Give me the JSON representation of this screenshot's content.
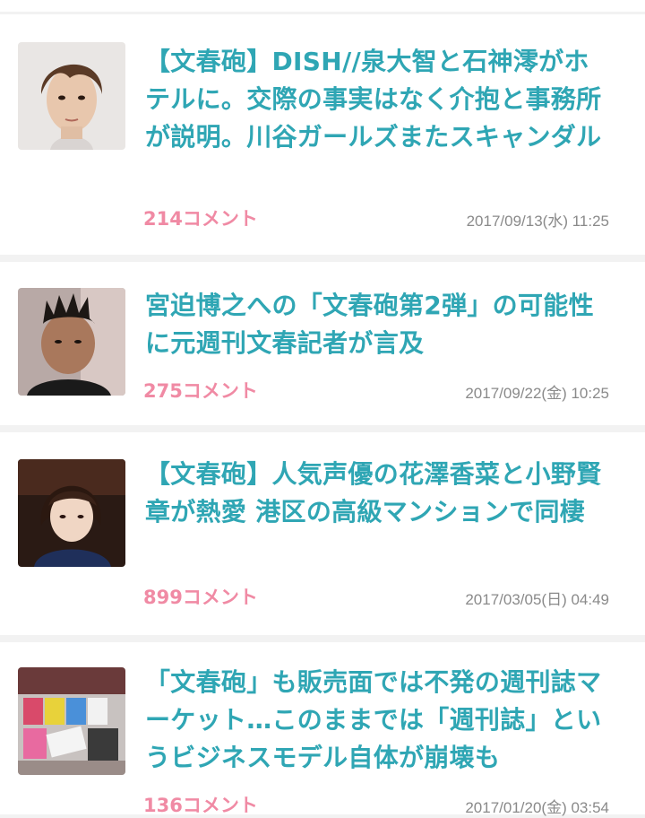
{
  "articles": [
    {
      "title": "【文春砲】DISH//泉大智と石神澪がホテルに。交際の事実はなく介抱と事務所が説明。川谷ガールズまたスキャンダル",
      "comments": "214コメント",
      "date": "2017/09/13(水) 11:25"
    },
    {
      "title": "宮迫博之への「文春砲第2弾」の可能性に元週刊文春記者が言及",
      "comments": "275コメント",
      "date": "2017/09/22(金) 10:25"
    },
    {
      "title": "【文春砲】人気声優の花澤香菜と小野賢章が熱愛 港区の高級マンションで同棲",
      "comments": "899コメント",
      "date": "2017/03/05(日) 04:49"
    },
    {
      "title": "「文春砲」も販売面では不発の週刊誌マーケット…このままでは「週刊誌」というビジネスモデル自体が崩壊も",
      "comments": "136コメント",
      "date": "2017/01/20(金) 03:54"
    }
  ]
}
